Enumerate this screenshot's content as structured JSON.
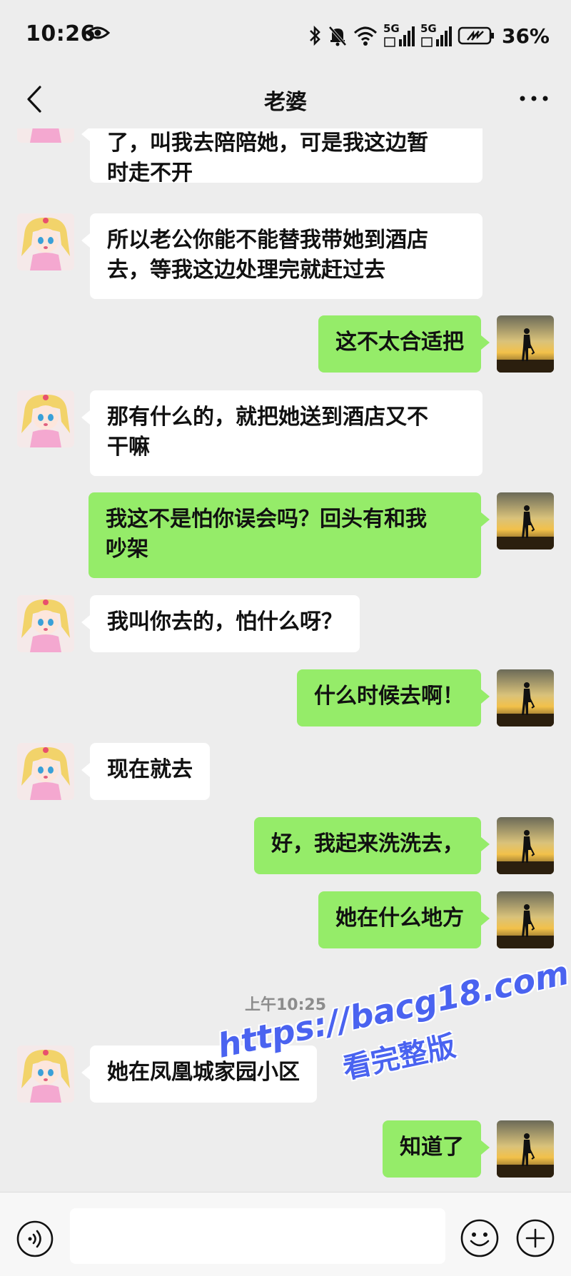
{
  "status_bar": {
    "time": "10:26",
    "network1": "5G",
    "network2": "5G",
    "battery": "36%"
  },
  "header": {
    "title": "老婆"
  },
  "messages": [
    {
      "side": "in",
      "text": "了，叫我去陪陪她，可是我这边暂\n时走不开"
    },
    {
      "side": "in",
      "text": "所以老公你能不能替我带她到酒店\n去，等我这边处理完就赶过去"
    },
    {
      "side": "out",
      "text": "这不太合适把"
    },
    {
      "side": "in",
      "text": "那有什么的，就把她送到酒店又不\n干嘛"
    },
    {
      "side": "out",
      "text": "我这不是怕你误会吗？回头有和我\n吵架"
    },
    {
      "side": "in",
      "text": "我叫你去的，怕什么呀？"
    },
    {
      "side": "out",
      "text": "什么时候去啊！"
    },
    {
      "side": "in",
      "text": "现在就去"
    },
    {
      "side": "out",
      "text": "好，我起来洗洗去，"
    },
    {
      "side": "out",
      "text": "她在什么地方"
    },
    {
      "side": "in",
      "text": "她在凤凰城家园小区"
    },
    {
      "side": "out",
      "text": "知道了"
    }
  ],
  "timestamp": "上午10:25",
  "watermark": {
    "line1": "https://bacg18.com",
    "line2": "看完整版"
  },
  "input_bar": {
    "placeholder": ""
  },
  "colors": {
    "background": "#ededed",
    "outgoing_bubble": "#95ec69",
    "incoming_bubble": "#ffffff",
    "watermark": "#4a63f0"
  },
  "icons": {
    "back": "chevron-left-icon",
    "more": "more-dots-icon",
    "voice": "voice-icon",
    "emoji": "emoji-icon",
    "plus": "plus-icon"
  }
}
